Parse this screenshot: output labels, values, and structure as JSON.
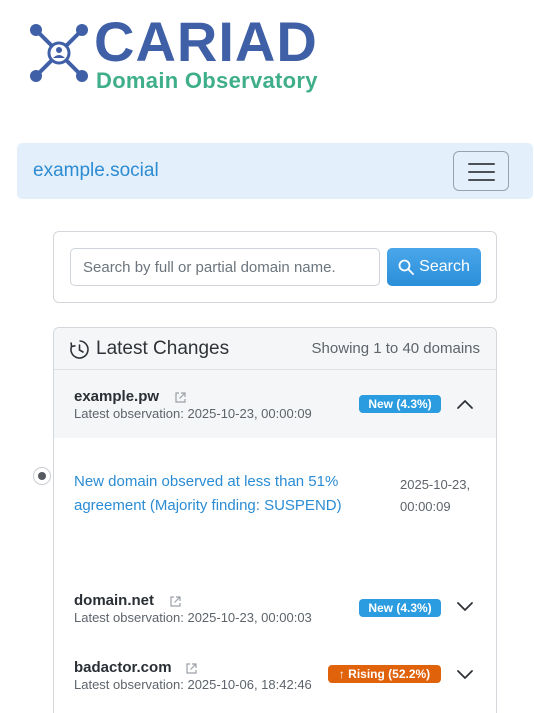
{
  "logo": {
    "title": "CARIAD",
    "subtitle": "Domain Observatory"
  },
  "navbar": {
    "brand": "example.social"
  },
  "search": {
    "placeholder": "Search by full or partial domain name.",
    "button_label": "Search"
  },
  "changes": {
    "title": "Latest Changes",
    "showing": "Showing 1 to 40 domains",
    "items": [
      {
        "domain": "example.pw",
        "observation": "Latest observation: 2025-10-23, 00:00:09",
        "badge": "New (4.3%)",
        "badge_type": "new",
        "expanded": true,
        "events": [
          {
            "text": "New domain observed at less than 51% agreement (Majority finding: SUSPEND)",
            "time": "2025-10-23, 00:00:09"
          }
        ]
      },
      {
        "domain": "domain.net",
        "observation": "Latest observation: 2025-10-23, 00:00:03",
        "badge": "New (4.3%)",
        "badge_type": "new",
        "expanded": false
      },
      {
        "domain": "badactor.com",
        "observation": "Latest observation: 2025-10-06, 18:42:46",
        "badge": "↑ Rising (52.2%)",
        "badge_type": "rising",
        "expanded": false
      }
    ]
  },
  "colors": {
    "brand_blue": "#3f5fa6",
    "brand_green": "#3fae8a",
    "accent": "#2a8fd9",
    "rising": "#e0620b"
  },
  "icons": [
    "cariad-network-icon",
    "menu-icon",
    "search-icon",
    "clock-icon",
    "external-link-icon",
    "chevron-up-icon",
    "chevron-down-icon"
  ]
}
